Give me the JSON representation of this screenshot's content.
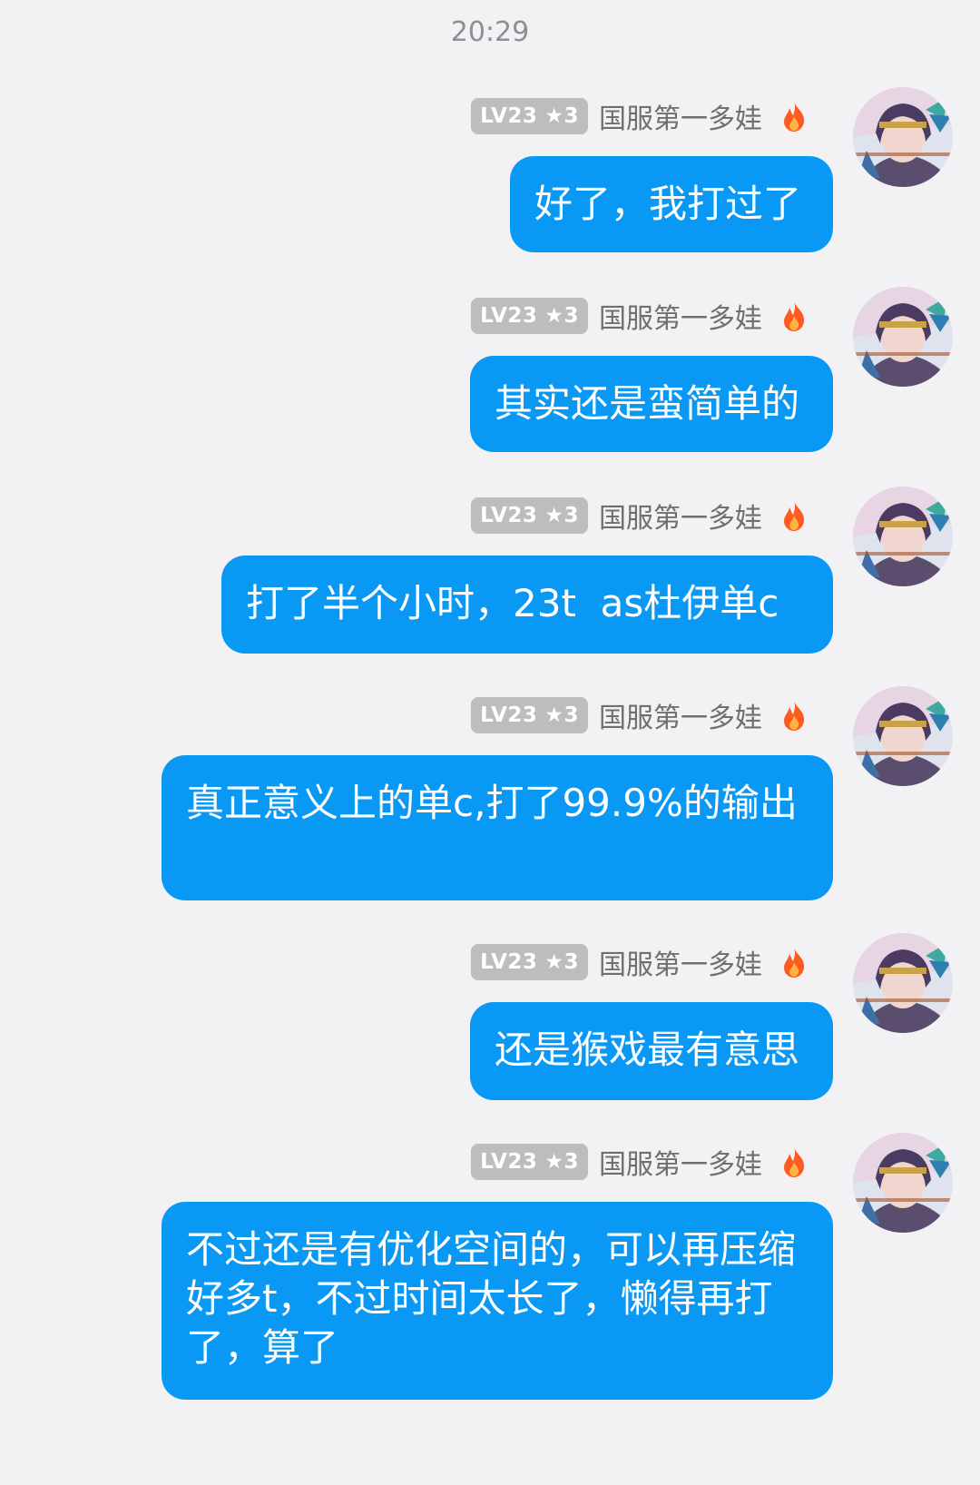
{
  "header": {
    "time": "20:29"
  },
  "messages": [
    {
      "badge_level": "LV23",
      "badge_star": "★3",
      "nickname": "国服第一多娃",
      "text": "好了，我打过了"
    },
    {
      "badge_level": "LV23",
      "badge_star": "★3",
      "nickname": "国服第一多娃",
      "text": "其实还是蛮简单的"
    },
    {
      "badge_level": "LV23",
      "badge_star": "★3",
      "nickname": "国服第一多娃",
      "text": "打了半个小时，23t  as杜伊单c"
    },
    {
      "badge_level": "LV23",
      "badge_star": "★3",
      "nickname": "国服第一多娃",
      "text": "真正意义上的单c,打了99.9%的输出"
    },
    {
      "badge_level": "LV23",
      "badge_star": "★3",
      "nickname": "国服第一多娃",
      "text": "还是猴戏最有意思"
    },
    {
      "badge_level": "LV23",
      "badge_star": "★3",
      "nickname": "国服第一多娃",
      "text": "不过还是有优化空间的，可以再压缩好多t，不过时间太长了，懒得再打了，算了"
    }
  ],
  "icons": {
    "flame": "flame-icon",
    "avatar": "user-avatar"
  },
  "colors": {
    "bubble": "#0a98f5",
    "background": "#f2f2f5",
    "badge": "#bdbdbd",
    "flame": "#ff5a1f"
  }
}
